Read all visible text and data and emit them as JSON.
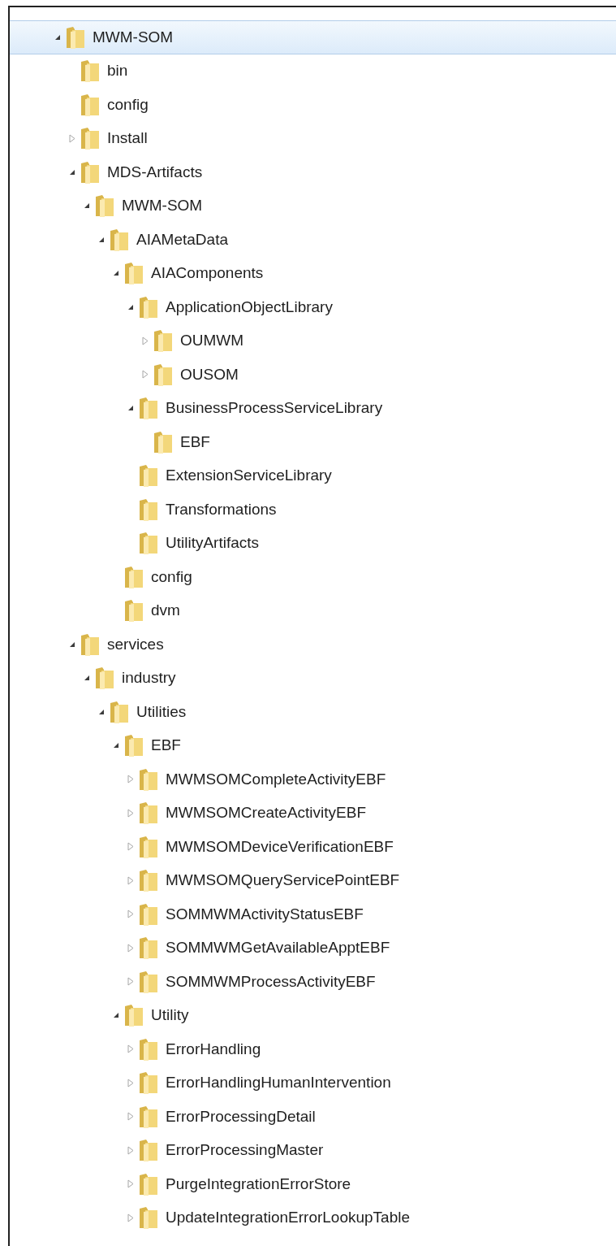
{
  "tree": [
    {
      "label": "MWM-SOM",
      "selected": true,
      "expanded": true,
      "children": [
        {
          "label": "bin",
          "selected": false
        },
        {
          "label": "config",
          "selected": false
        },
        {
          "label": "Install",
          "selected": false,
          "expanded": false
        },
        {
          "label": "MDS-Artifacts",
          "selected": false,
          "expanded": true,
          "children": [
            {
              "label": "MWM-SOM",
              "selected": false,
              "expanded": true,
              "children": [
                {
                  "label": "AIAMetaData",
                  "selected": false,
                  "expanded": true,
                  "children": [
                    {
                      "label": "AIAComponents",
                      "selected": false,
                      "expanded": true,
                      "children": [
                        {
                          "label": "ApplicationObjectLibrary",
                          "selected": false,
                          "expanded": true,
                          "children": [
                            {
                              "label": "OUMWM",
                              "selected": false,
                              "expanded": false
                            },
                            {
                              "label": "OUSOM",
                              "selected": false,
                              "expanded": false
                            }
                          ]
                        },
                        {
                          "label": "BusinessProcessServiceLibrary",
                          "selected": false,
                          "expanded": true,
                          "children": [
                            {
                              "label": "EBF",
                              "selected": false
                            }
                          ]
                        },
                        {
                          "label": "ExtensionServiceLibrary",
                          "selected": false
                        },
                        {
                          "label": "Transformations",
                          "selected": false
                        },
                        {
                          "label": "UtilityArtifacts",
                          "selected": false
                        }
                      ]
                    },
                    {
                      "label": "config",
                      "selected": false
                    },
                    {
                      "label": "dvm",
                      "selected": false
                    }
                  ]
                }
              ]
            }
          ]
        },
        {
          "label": "services",
          "selected": false,
          "expanded": true,
          "children": [
            {
              "label": "industry",
              "selected": false,
              "expanded": true,
              "children": [
                {
                  "label": "Utilities",
                  "selected": false,
                  "expanded": true,
                  "children": [
                    {
                      "label": "EBF",
                      "selected": false,
                      "expanded": true,
                      "children": [
                        {
                          "label": "MWMSOMCompleteActivityEBF",
                          "selected": false,
                          "expanded": false
                        },
                        {
                          "label": "MWMSOMCreateActivityEBF",
                          "selected": false,
                          "expanded": false
                        },
                        {
                          "label": "MWMSOMDeviceVerificationEBF",
                          "selected": false,
                          "expanded": false
                        },
                        {
                          "label": "MWMSOMQueryServicePointEBF",
                          "selected": false,
                          "expanded": false
                        },
                        {
                          "label": "SOMMWMActivityStatusEBF",
                          "selected": false,
                          "expanded": false
                        },
                        {
                          "label": "SOMMWMGetAvailableApptEBF",
                          "selected": false,
                          "expanded": false
                        },
                        {
                          "label": "SOMMWMProcessActivityEBF",
                          "selected": false,
                          "expanded": false
                        }
                      ]
                    },
                    {
                      "label": "Utility",
                      "selected": false,
                      "expanded": true,
                      "children": [
                        {
                          "label": "ErrorHandling",
                          "selected": false,
                          "expanded": false
                        },
                        {
                          "label": "ErrorHandlingHumanIntervention",
                          "selected": false,
                          "expanded": false
                        },
                        {
                          "label": "ErrorProcessingDetail",
                          "selected": false,
                          "expanded": false
                        },
                        {
                          "label": "ErrorProcessingMaster",
                          "selected": false,
                          "expanded": false
                        },
                        {
                          "label": "PurgeIntegrationErrorStore",
                          "selected": false,
                          "expanded": false
                        },
                        {
                          "label": "UpdateIntegrationErrorLookupTable",
                          "selected": false,
                          "expanded": false
                        }
                      ]
                    }
                  ]
                }
              ]
            }
          ]
        }
      ]
    }
  ]
}
